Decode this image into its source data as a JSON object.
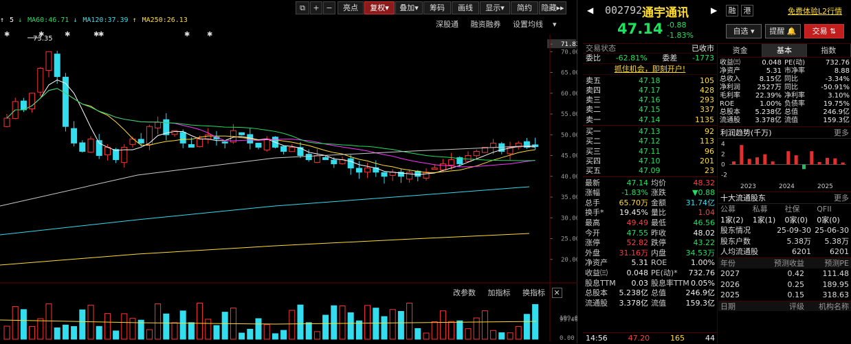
{
  "toolbar": {
    "buttons": [
      "亮点",
      "复权",
      "叠加",
      "筹码",
      "画线",
      "显示",
      "简约",
      "隐藏"
    ],
    "active": "复权",
    "dropdowns": [
      "复权",
      "叠加",
      "显示"
    ]
  },
  "ma_legend": [
    {
      "label": "5",
      "color": "#ffffff",
      "arrow": "↑"
    },
    {
      "label": "MA60:46.71",
      "color": "#20e060",
      "arrow": "↓"
    },
    {
      "label": "MA120:37.39",
      "color": "#33ddee",
      "arrow": "↓"
    },
    {
      "label": "MA250:26.13",
      "color": "#ffdd33",
      "arrow": "↑"
    }
  ],
  "sublinks": {
    "links": [
      "深股通",
      "融资融券",
      "设置均线"
    ]
  },
  "price_axis": {
    "labels": [
      "71.83",
      "70.00",
      "65.00",
      "60.00",
      "55.00",
      "50.00",
      "45.00",
      "40.00",
      "35.00",
      "30.00",
      "25.00",
      "20.00"
    ],
    "high_marker": "73.35"
  },
  "volume": {
    "links": [
      "改参数",
      "加指标",
      "换指标"
    ],
    "labels": [
      "199.00",
      "99.40",
      "0.00"
    ]
  },
  "stock": {
    "code": "002792",
    "name": "通宇通讯",
    "tag1": "融",
    "tag2": "港",
    "promo": "免费体验L2行情",
    "price": "47.14",
    "change": "-0.88",
    "pct": "-1.83%",
    "btn_watch": "自选",
    "btn_alert": "提醒",
    "btn_trade": "交易"
  },
  "status": {
    "label": "交易状态",
    "value": "已收市"
  },
  "bidratio": {
    "k1": "委比",
    "v1": "-62.81%",
    "k2": "委差",
    "v2": "-1773"
  },
  "ad_link": "抓住机会，即刻开户!",
  "asks": [
    {
      "label": "卖五",
      "price": "47.18",
      "vol": "105"
    },
    {
      "label": "卖四",
      "price": "47.17",
      "vol": "428"
    },
    {
      "label": "卖三",
      "price": "47.16",
      "vol": "293"
    },
    {
      "label": "卖二",
      "price": "47.15",
      "vol": "337"
    },
    {
      "label": "卖一",
      "price": "47.14",
      "vol": "1135"
    }
  ],
  "bids": [
    {
      "label": "买一",
      "price": "47.13",
      "vol": "92"
    },
    {
      "label": "买二",
      "price": "47.12",
      "vol": "113"
    },
    {
      "label": "买三",
      "price": "47.11",
      "vol": "96"
    },
    {
      "label": "买四",
      "price": "47.10",
      "vol": "201"
    },
    {
      "label": "买五",
      "price": "47.09",
      "vol": "23"
    }
  ],
  "quote": [
    {
      "k": "最新",
      "v": "47.14",
      "vc": "green",
      "k2": "均价",
      "v2": "48.32",
      "v2c": "red"
    },
    {
      "k": "涨幅",
      "v": "-1.83%",
      "vc": "green",
      "k2": "涨跌",
      "v2": "▼0.88",
      "v2c": "green"
    },
    {
      "k": "总手",
      "v": "65.70万",
      "vc": "yellow",
      "k2": "金额",
      "v2": "31.74亿",
      "v2c": "cyan"
    },
    {
      "k": "换手*",
      "v": "19.45%",
      "vc": "white",
      "k2": "量比",
      "v2": "1.04",
      "v2c": "red"
    },
    {
      "k": "最高",
      "v": "49.49",
      "vc": "red",
      "k2": "最低",
      "v2": "46.56",
      "v2c": "green"
    },
    {
      "k": "今开",
      "v": "47.55",
      "vc": "green",
      "k2": "昨收",
      "v2": "48.02",
      "v2c": "white"
    },
    {
      "k": "涨停",
      "v": "52.82",
      "vc": "red",
      "k2": "跌停",
      "v2": "43.22",
      "v2c": "green"
    },
    {
      "k": "外盘",
      "v": "31.16万",
      "vc": "red",
      "k2": "内盘",
      "v2": "34.53万",
      "v2c": "green"
    },
    {
      "k": "净资产",
      "v": "5.31",
      "vc": "white",
      "k2": "ROE",
      "v2": "1.00%",
      "v2c": "white"
    },
    {
      "k": "收益㈢",
      "v": "0.048",
      "vc": "white",
      "k2": "PE(动)*",
      "v2": "732.76",
      "v2c": "white"
    },
    {
      "k": "股息TTM",
      "v": "0.03",
      "vc": "white",
      "k2": "股息率TTM",
      "v2": "0.05%",
      "v2c": "white"
    },
    {
      "k": "总股本",
      "v": "5.238亿",
      "vc": "white",
      "k2": "总值",
      "v2": "246.9亿",
      "v2c": "white"
    },
    {
      "k": "流通股",
      "v": "3.378亿",
      "vc": "white",
      "k2": "流值",
      "v2": "159.3亿",
      "v2c": "white"
    }
  ],
  "tick": {
    "time": "14:56",
    "price": "47.20",
    "vol": "165",
    "num": "44"
  },
  "right_tabs": [
    "资金",
    "基本",
    "指数"
  ],
  "right_tab_active": "基本",
  "fin": [
    {
      "k": "收益㈢",
      "v": "0.048",
      "k2": "PE(动)",
      "v2": "732.76"
    },
    {
      "k": "净资产",
      "v": "5.31",
      "k2": "市净率",
      "v2": "8.88"
    },
    {
      "k": "总收入",
      "v": "8.15亿",
      "k2": "同比",
      "v2": "-3.34%"
    },
    {
      "k": "净利润",
      "v": "2527万",
      "k2": "同比",
      "v2": "-50.91%"
    },
    {
      "k": "毛利率",
      "v": "22.39%",
      "k2": "净利率",
      "v2": "3.10%"
    },
    {
      "k": "ROE",
      "v": "1.00%",
      "k2": "负债率",
      "v2": "19.75%"
    },
    {
      "k": "总股本",
      "v": "5.238亿",
      "k2": "总值",
      "v2": "246.9亿"
    },
    {
      "k": "流通股",
      "v": "3.378亿",
      "k2": "流值",
      "v2": "159.3亿"
    }
  ],
  "profit": {
    "title": "利润趋势(千万)",
    "more": "更多",
    "ylabels": [
      "4",
      "2",
      "0",
      "-2"
    ],
    "years": [
      "2023",
      "2024",
      "2025"
    ]
  },
  "chart_data": {
    "type": "bar",
    "title": "利润趋势(千万)",
    "xlabel": "",
    "ylabel": "",
    "ylim": [
      -3,
      4.5
    ],
    "values": [
      0.6,
      3.8,
      1.1,
      1.4,
      2.0,
      0.6,
      0,
      2.6,
      1.8,
      -0.9,
      2.6,
      0.5,
      1.3,
      1.2,
      0.4
    ]
  },
  "holders": {
    "title": "十大流通股东",
    "more": "更多",
    "head": [
      "公募",
      "私募",
      "社保",
      "QFII"
    ],
    "counts": [
      "1家(2)",
      "1家(1)",
      "0家(0)",
      "0家(0)"
    ],
    "rows": [
      {
        "a": "股东情况",
        "b": "25-09-30",
        "c": "25-06-30"
      },
      {
        "a": "股东户数",
        "b": "5.38万",
        "c": "5.38万"
      },
      {
        "a": "人均流通股",
        "b": "6201",
        "c": "6201"
      }
    ]
  },
  "forecast": {
    "head": [
      "年份",
      "预测收益",
      "预测PE"
    ],
    "rows": [
      {
        "y": "2027",
        "e": "0.42",
        "pe": "111.48"
      },
      {
        "y": "2026",
        "e": "0.25",
        "pe": "189.95"
      },
      {
        "y": "2025",
        "e": "0.15",
        "pe": "318.63"
      }
    ],
    "rating_head": [
      "日期",
      "评级",
      "机构名称"
    ]
  }
}
